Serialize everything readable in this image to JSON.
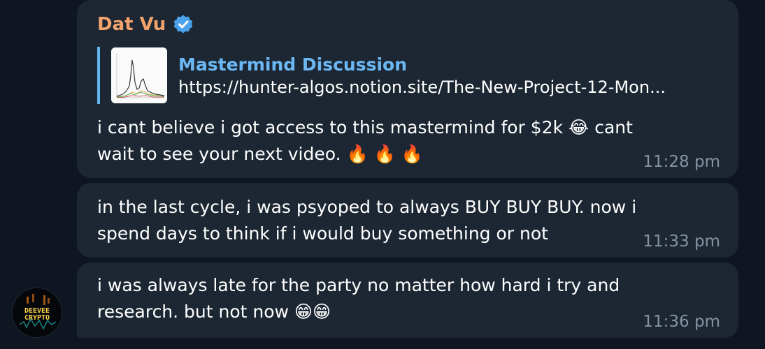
{
  "messages": [
    {
      "sender": "Dat Vu",
      "verified": true,
      "link_preview": {
        "title": "Mastermind Discussion",
        "url": "https://hunter-algos.notion.site/The-New-Project-12-Mon..."
      },
      "text": "i cant believe i got access to this mastermind for $2k 😂 cant wait to see your next video. 🔥 🔥 🔥",
      "time": "11:28 pm"
    },
    {
      "text": "in the last cycle, i was psyoped to always BUY BUY BUY. now i spend days to think if i would buy something or not",
      "time": "11:33 pm"
    },
    {
      "text": "i was always late for the party no matter how hard i try and research. but not now 😁😁",
      "time": "11:36 pm"
    }
  ],
  "avatar": {
    "line1": "DEEVEE",
    "line2": "CRYPTO"
  },
  "colors": {
    "background": "#0f1621",
    "bubble": "#1c2733",
    "sender": "#f3a36b",
    "link": "#6cb8f4",
    "accent_bar": "#60b3ee",
    "time": "#8593a1"
  }
}
